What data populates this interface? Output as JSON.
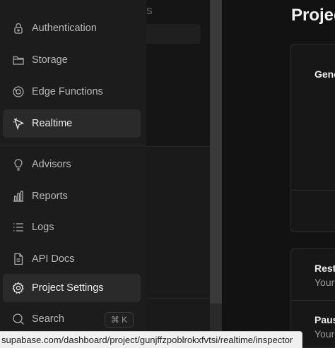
{
  "sidebar": {
    "items": [
      {
        "label": "Authentication",
        "icon": "user-lock-icon"
      },
      {
        "label": "Storage",
        "icon": "folder-icon"
      },
      {
        "label": "Edge Functions",
        "icon": "edge-functions-icon"
      },
      {
        "label": "Realtime",
        "icon": "realtime-cursor-icon",
        "active": true
      },
      {
        "label": "Advisors",
        "icon": "lightbulb-icon"
      },
      {
        "label": "Reports",
        "icon": "bar-chart-icon"
      },
      {
        "label": "Logs",
        "icon": "list-icon"
      },
      {
        "label": "API Docs",
        "icon": "file-text-icon"
      },
      {
        "label": "Project Settings",
        "icon": "gear-icon",
        "active": true
      }
    ],
    "search_label": "Search",
    "search_shortcut": "⌘ K"
  },
  "middle_panel": {
    "partial_letter": "S"
  },
  "main": {
    "page_title": "Projec",
    "cards": [
      {
        "title": "Gene"
      },
      {
        "title": "Resta",
        "subtitle": "Your"
      },
      {
        "title": "Paus",
        "subtitle": "Your"
      }
    ]
  },
  "statusbar": {
    "url": "supabase.com/dashboard/project/gunjffzpoblrokxfvtsi/realtime/inspector"
  },
  "colors": {
    "background": "#1c1c1c",
    "active_item": "#2a2a2a",
    "text": "#ededed",
    "muted_text": "#b8b8b8"
  }
}
